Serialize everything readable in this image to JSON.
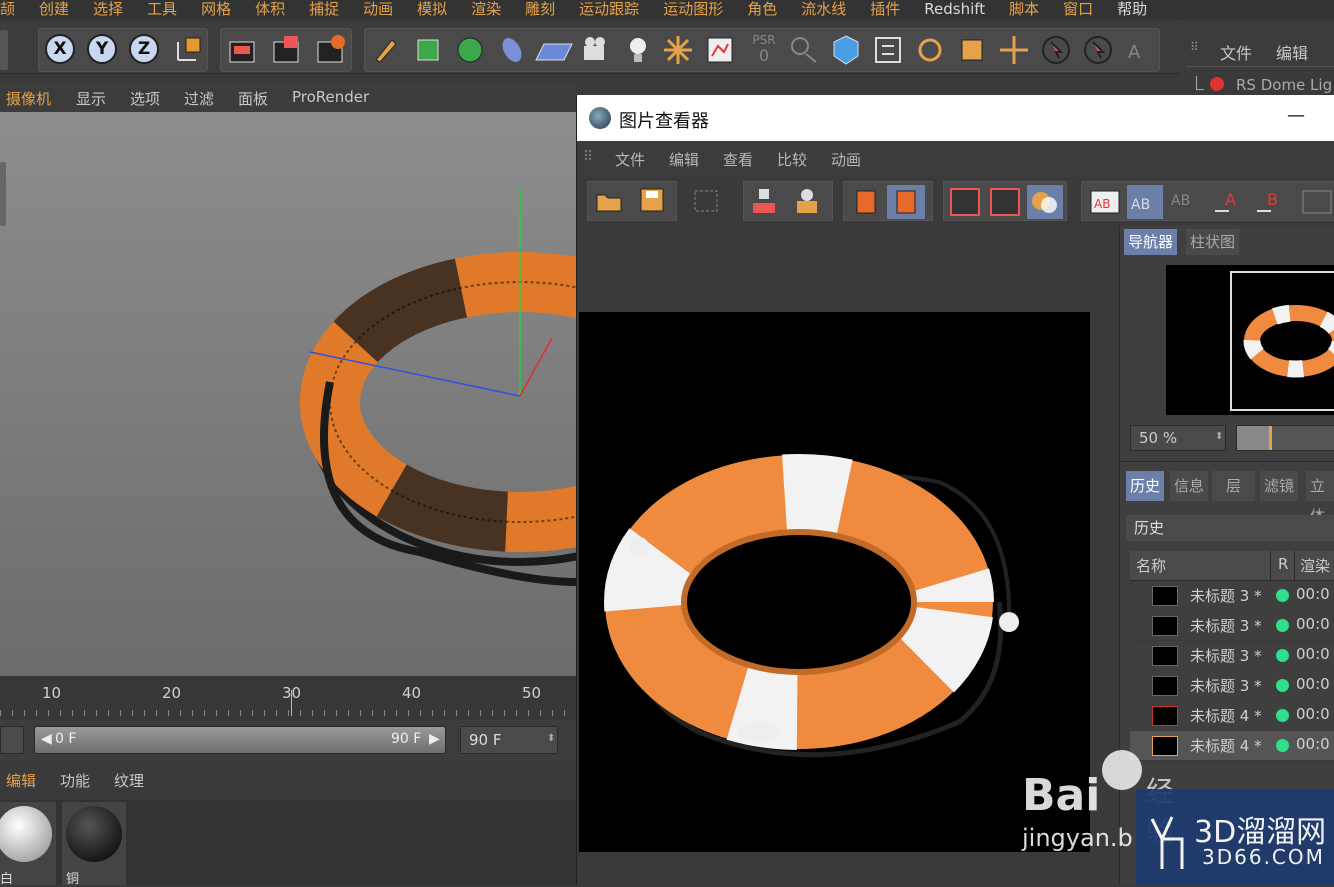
{
  "menubar": {
    "items": [
      "颉",
      "创建",
      "选择",
      "工具",
      "网格",
      "体积",
      "捕捉",
      "动画",
      "模拟",
      "渲染",
      "雕刻",
      "运动跟踪",
      "运动图形",
      "角色",
      "流水线",
      "插件",
      "Redshift",
      "脚本",
      "窗口",
      "帮助"
    ]
  },
  "toolbar": {
    "x": "X",
    "y": "Y",
    "z": "Z",
    "psr": "PSR",
    "psr_val": "0"
  },
  "objects": {
    "menu": [
      "文件",
      "编辑"
    ],
    "item": "RS Dome Lig"
  },
  "viewport": {
    "menu": [
      "摄像机",
      "显示",
      "选项",
      "过滤",
      "面板",
      "ProRender"
    ]
  },
  "timeline": {
    "ticks": [
      "10",
      "20",
      "30",
      "40",
      "50"
    ],
    "start": "0 F",
    "end": "90 F",
    "end2": "90 F"
  },
  "materials": {
    "menu": [
      "编辑",
      "功能",
      "纹理"
    ],
    "labels": [
      "白",
      "铜"
    ]
  },
  "picture_viewer": {
    "title": "图片查看器",
    "minimize": "—",
    "menu": [
      "文件",
      "编辑",
      "查看",
      "比较",
      "动画"
    ],
    "side_tabs": [
      "导航器",
      "柱状图"
    ],
    "zoom": "50 %",
    "panel_tabs": [
      "历史",
      "信息",
      "层",
      "滤镜",
      "立体"
    ],
    "history_title": "历史",
    "columns": [
      "名称",
      "R",
      "渲染"
    ],
    "rows": [
      {
        "name": "未标题 3 *",
        "time": "00:0"
      },
      {
        "name": "未标题 3 *",
        "time": "00:0"
      },
      {
        "name": "未标题 3 *",
        "time": "00:0"
      },
      {
        "name": "未标题 3 *",
        "time": "00:0"
      },
      {
        "name": "未标题 4 *",
        "time": "00:0"
      },
      {
        "name": "未标题 4 *",
        "time": "00:0"
      }
    ]
  },
  "watermark": {
    "baidu": "Bai",
    "jingyan": "jingyan.b",
    "jy": "经验",
    "site": "3D溜溜网",
    "url": "3D66.COM"
  },
  "colors": {
    "orange": "#e88a3e",
    "accent": "#e5a24a",
    "green": "#2ee08a",
    "blue_tab": "#6b7fa8"
  }
}
